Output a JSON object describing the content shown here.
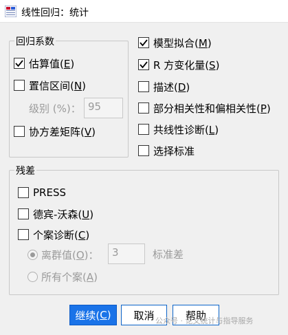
{
  "window": {
    "title": "线性回归：统计"
  },
  "coefficients": {
    "group_label": "回归系数",
    "estimates": {
      "label": "估算值(",
      "key": "E",
      "suffix": ")",
      "checked": true
    },
    "confidence": {
      "label": "置信区间(",
      "key": "N",
      "suffix": ")",
      "checked": false
    },
    "level_label": "级别 (%)：",
    "level_value": "95",
    "covariance": {
      "label": "协方差矩阵(",
      "key": "V",
      "suffix": ")",
      "checked": false
    }
  },
  "right_options": [
    {
      "label": "模型拟合(",
      "key": "M",
      "suffix": ")",
      "checked": true
    },
    {
      "label": "R 方变化量(",
      "key": "S",
      "suffix": ")",
      "checked": true
    },
    {
      "label": "描述(",
      "key": "D",
      "suffix": ")",
      "checked": false
    },
    {
      "label": "部分相关性和偏相关性(",
      "key": "P",
      "suffix": ")",
      "checked": false
    },
    {
      "label": "共线性诊断(",
      "key": "L",
      "suffix": ")",
      "checked": false
    },
    {
      "label": "选择标准",
      "key": "",
      "suffix": "",
      "checked": false
    }
  ],
  "residuals": {
    "group_label": "残差",
    "press": {
      "label": "PRESS",
      "checked": false
    },
    "durbin_watson": {
      "label": "德宾-沃森(",
      "key": "U",
      "suffix": ")",
      "checked": false
    },
    "casewise": {
      "label": "个案诊断(",
      "key": "C",
      "suffix": ")",
      "checked": false
    },
    "outliers": {
      "label": "离群值(",
      "key": "O",
      "suffix": ")：",
      "selected": true
    },
    "outlier_value": "3",
    "outlier_unit": "标准差",
    "all_cases": {
      "label": "所有个案(",
      "key": "A",
      "suffix": ")",
      "selected": false
    }
  },
  "buttons": {
    "continue": {
      "label": "继续(",
      "key": "C",
      "suffix": ")"
    },
    "cancel": "取消",
    "help": "帮助"
  },
  "watermark": "公众号 · 论文统计与指导服务"
}
